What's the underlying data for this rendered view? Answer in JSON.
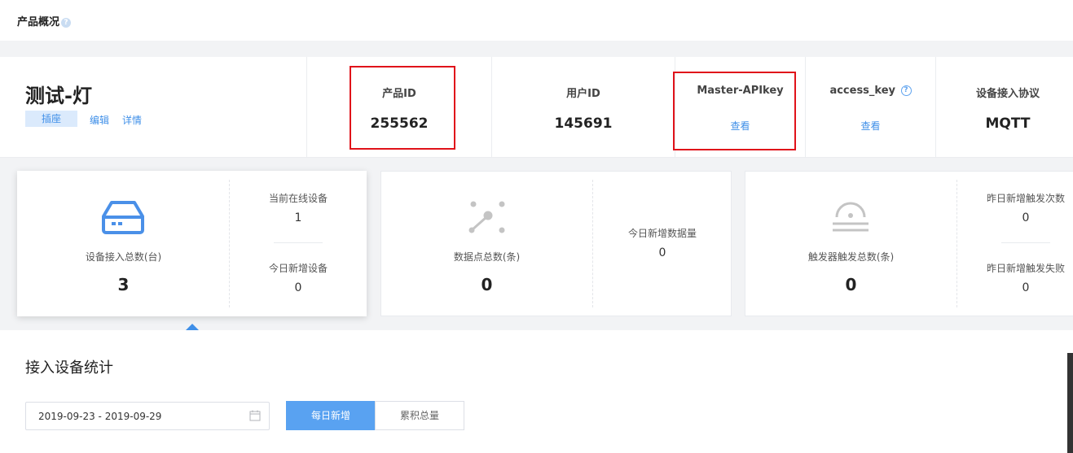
{
  "header": {
    "title": "产品概况",
    "help_glyph": "?"
  },
  "product": {
    "name": "测试-灯",
    "tag": "插座",
    "edit_label": "编辑",
    "detail_label": "详情"
  },
  "info_cells": {
    "product_id": {
      "label": "产品ID",
      "value": "255562"
    },
    "user_id": {
      "label": "用户ID",
      "value": "145691"
    },
    "master_apikey": {
      "label": "Master-APIkey",
      "action": "查看"
    },
    "access_key": {
      "label": "access_key",
      "action": "查看",
      "help_glyph": "?"
    },
    "protocol": {
      "label": "设备接入协议",
      "value": "MQTT"
    }
  },
  "highlight_color": "#e0121a",
  "accent_color": "#3f8fe8",
  "cards": {
    "devices": {
      "icon": "device-icon",
      "main_label": "设备接入总数(台)",
      "main_value": "3",
      "sub1_label": "当前在线设备",
      "sub1_value": "1",
      "sub2_label": "今日新增设备",
      "sub2_value": "0"
    },
    "datapoints": {
      "icon": "datapoint-icon",
      "main_label": "数据点总数(条)",
      "main_value": "0",
      "sub1_label": "今日新增数据量",
      "sub1_value": "0"
    },
    "triggers": {
      "icon": "trigger-icon",
      "main_label": "触发器触发总数(条)",
      "main_value": "0",
      "sub1_label": "昨日新增触发次数",
      "sub1_value": "0",
      "sub2_label": "昨日新增触发失败",
      "sub2_value": "0"
    }
  },
  "stats_section": {
    "title": "接入设备统计",
    "date_range": "2019-09-23 - 2019-09-29",
    "toggle_daily": "每日新增",
    "toggle_total": "累积总量"
  }
}
